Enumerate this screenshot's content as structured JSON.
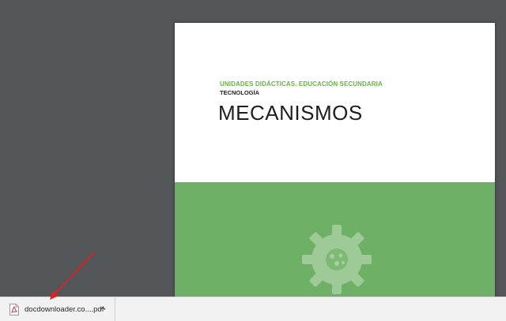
{
  "document": {
    "subtitle": "UNIDADES DIDÁCTICAS. EDUCACIÓN SECUNDARIA",
    "subject": "TECNOLOGÍA",
    "title": "MECANISMOS"
  },
  "download_bar": {
    "file_name": "docdownloader.co....pdf",
    "file_icon": "pdf-file-icon",
    "menu_icon": "chevron-up-icon"
  },
  "annotation": {
    "type": "red-arrow",
    "color": "#e02020"
  },
  "colors": {
    "viewer_background": "#525659",
    "cover_green": "#6db066",
    "subtitle_green": "#6ab04c"
  }
}
